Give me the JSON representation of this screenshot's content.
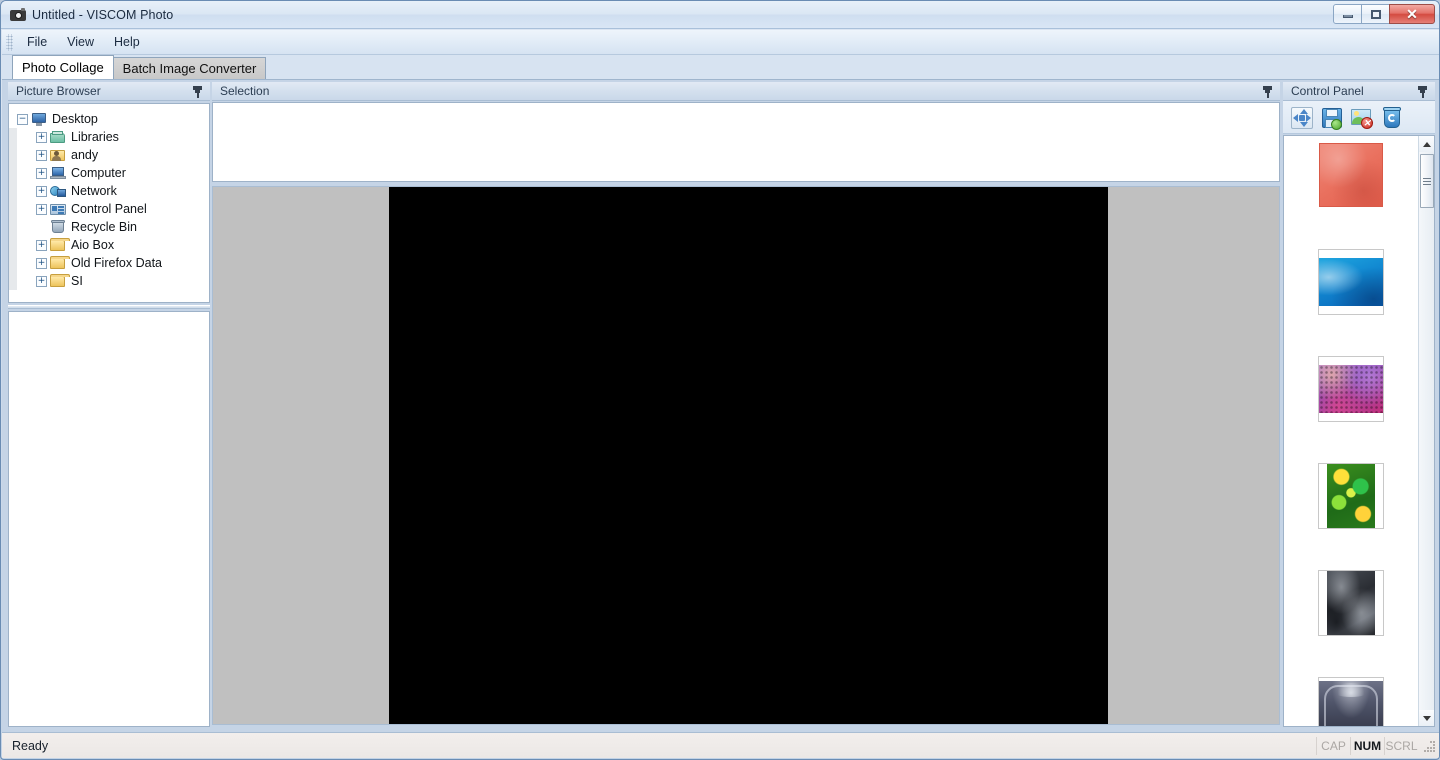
{
  "window": {
    "title": "Untitled - VISCOM Photo",
    "app_icon": "camera-icon",
    "controls": {
      "minimize": "minimize-icon",
      "maximize": "maximize-icon",
      "close": "✕"
    }
  },
  "menu": {
    "items": [
      {
        "label": "File"
      },
      {
        "label": "View"
      },
      {
        "label": "Help"
      }
    ]
  },
  "tabs": [
    {
      "label": "Photo Collage",
      "active": true
    },
    {
      "label": "Batch Image Converter",
      "active": false
    }
  ],
  "picture_browser": {
    "title": "Picture Browser",
    "pin": "pin-icon",
    "tree": [
      {
        "label": "Desktop",
        "level": 0,
        "expander": "minus",
        "icon": "monitor"
      },
      {
        "label": "Libraries",
        "level": 1,
        "expander": "plus",
        "icon": "libraries"
      },
      {
        "label": "andy",
        "level": 1,
        "expander": "plus",
        "icon": "user"
      },
      {
        "label": "Computer",
        "level": 1,
        "expander": "plus",
        "icon": "computer"
      },
      {
        "label": "Network",
        "level": 1,
        "expander": "plus",
        "icon": "network"
      },
      {
        "label": "Control Panel",
        "level": 1,
        "expander": "plus",
        "icon": "cpanel"
      },
      {
        "label": "Recycle Bin",
        "level": 1,
        "expander": "none",
        "icon": "recycle"
      },
      {
        "label": "Aio Box",
        "level": 1,
        "expander": "plus",
        "icon": "folder"
      },
      {
        "label": "Old Firefox Data",
        "level": 1,
        "expander": "plus",
        "icon": "folder"
      },
      {
        "label": "SI",
        "level": 1,
        "expander": "plus",
        "icon": "folder"
      }
    ]
  },
  "selection": {
    "title": "Selection",
    "pin": "pin-icon"
  },
  "canvas": {
    "background_color": "#c0c0c0",
    "collage_color": "#000000"
  },
  "control_panel": {
    "title": "Control Panel",
    "pin": "pin-icon",
    "toolbar": [
      {
        "name": "arrange-images-button",
        "icon": "move-icon"
      },
      {
        "name": "save-collage-button",
        "icon": "save-icon"
      },
      {
        "name": "remove-image-button",
        "icon": "delete-image-icon"
      },
      {
        "name": "clear-all-button",
        "icon": "recycle-bin-icon"
      }
    ],
    "thumbnails": [
      {
        "name": "thumbnail-coral-texture",
        "art": "art-coral"
      },
      {
        "name": "thumbnail-blue-waves",
        "art": "art-blue"
      },
      {
        "name": "thumbnail-hex-bokeh",
        "art": "art-hex"
      },
      {
        "name": "thumbnail-green-circles",
        "art": "art-green"
      },
      {
        "name": "thumbnail-grey-silk",
        "art": "art-silk"
      },
      {
        "name": "thumbnail-ornate-frame",
        "art": "art-frame"
      }
    ],
    "scrollbar": {
      "up": "▲",
      "down": "▼"
    }
  },
  "status_bar": {
    "message": "Ready",
    "indicators": [
      {
        "label": "CAP",
        "active": false
      },
      {
        "label": "NUM",
        "active": true
      },
      {
        "label": "SCRL",
        "active": false
      }
    ]
  },
  "colors": {
    "title_bar": "#dbe7f4",
    "panel_header": "#d4e0ee",
    "canvas_bg": "#c0c0c0",
    "collage": "#000000",
    "close_button": "#d44b41",
    "accent": "#4a86c8"
  }
}
